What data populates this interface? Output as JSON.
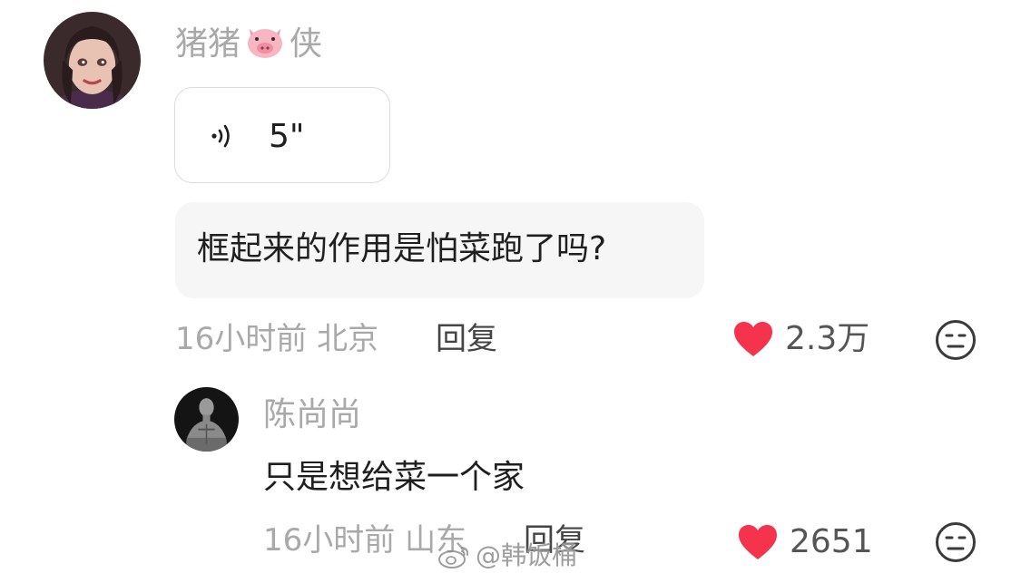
{
  "comment": {
    "username_prefix": "猪猪",
    "username_emoji": "pig-face-emoji",
    "username_suffix": "侠",
    "voice_duration": "5\"",
    "text": "框起来的作用是怕菜跑了吗?",
    "time_location": "16小时前 北京",
    "reply_label": "回复",
    "like_count": "2.3万"
  },
  "reply": {
    "username": "陈尚尚",
    "text": "只是想给菜一个家",
    "time_location": "16小时前 山东",
    "reply_label": "回复",
    "like_count": "2651"
  },
  "watermark": {
    "text": "@韩饭桶"
  },
  "colors": {
    "heart": "#f5334d",
    "muted_text": "#a9a9a9",
    "bubble_bg": "#f6f6f6"
  }
}
